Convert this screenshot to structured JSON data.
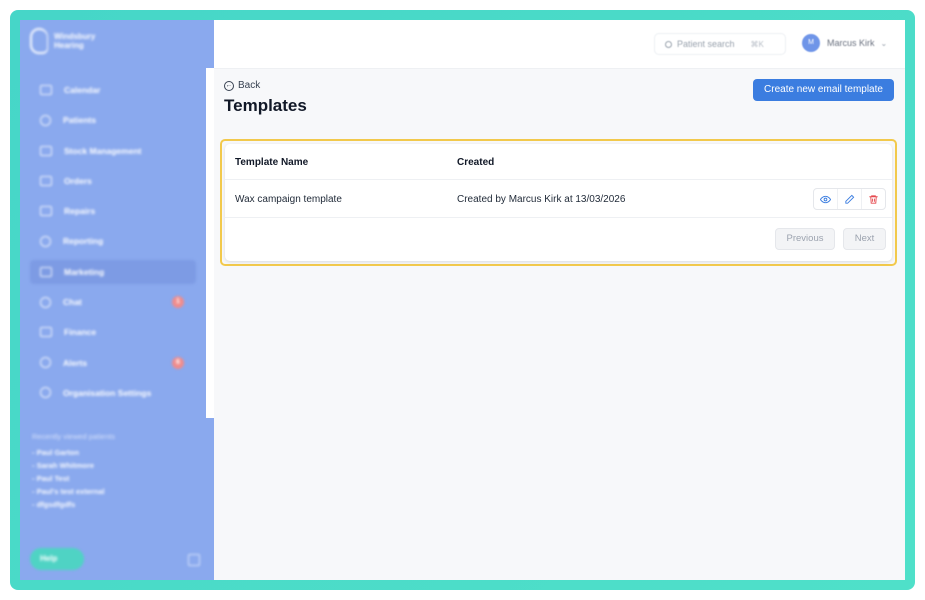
{
  "brand": {
    "name_line1": "Windsbury",
    "name_line2": "Hearing"
  },
  "sidebar": {
    "items": [
      {
        "label": "Calendar",
        "icon": "calendar-icon"
      },
      {
        "label": "Patients",
        "icon": "users-icon"
      },
      {
        "label": "Stock Management",
        "icon": "box-icon"
      },
      {
        "label": "Orders",
        "icon": "clipboard-icon"
      },
      {
        "label": "Repairs",
        "icon": "wrench-icon"
      },
      {
        "label": "Reporting",
        "icon": "chart-pie-icon"
      },
      {
        "label": "Marketing",
        "icon": "mail-icon",
        "active": true
      },
      {
        "label": "Chat",
        "icon": "chat-icon",
        "badge": "1"
      },
      {
        "label": "Finance",
        "icon": "credit-card-icon"
      },
      {
        "label": "Alerts",
        "icon": "bell-icon",
        "badge": "6"
      },
      {
        "label": "Organisation Settings",
        "icon": "gear-icon"
      }
    ],
    "recent_title": "Recently viewed patients",
    "recent": [
      "- Paul Garton",
      "- Sarah Whitmore",
      "- Paul Test",
      "- Paul's test external",
      "- dfgsdfgdfs"
    ],
    "help_label": "Help"
  },
  "topbar": {
    "search_placeholder": "Patient search",
    "search_shortcut": "⌘K",
    "user_initials": "M",
    "user_name": "Marcus Kirk"
  },
  "main": {
    "back_label": "Back",
    "title": "Templates",
    "create_label": "Create new email template",
    "table": {
      "columns": [
        "Template Name",
        "Created"
      ],
      "rows": [
        {
          "name": "Wax campaign template",
          "created": "Created by Marcus Kirk at 13/03/2026"
        }
      ]
    },
    "pagination": {
      "previous": "Previous",
      "next": "Next"
    }
  },
  "colors": {
    "accent": "#3b7de0",
    "sidebar": "#8aa9ee",
    "frame": "#46d6c8",
    "highlight": "#f2c94c",
    "delete": "#e5484d"
  }
}
